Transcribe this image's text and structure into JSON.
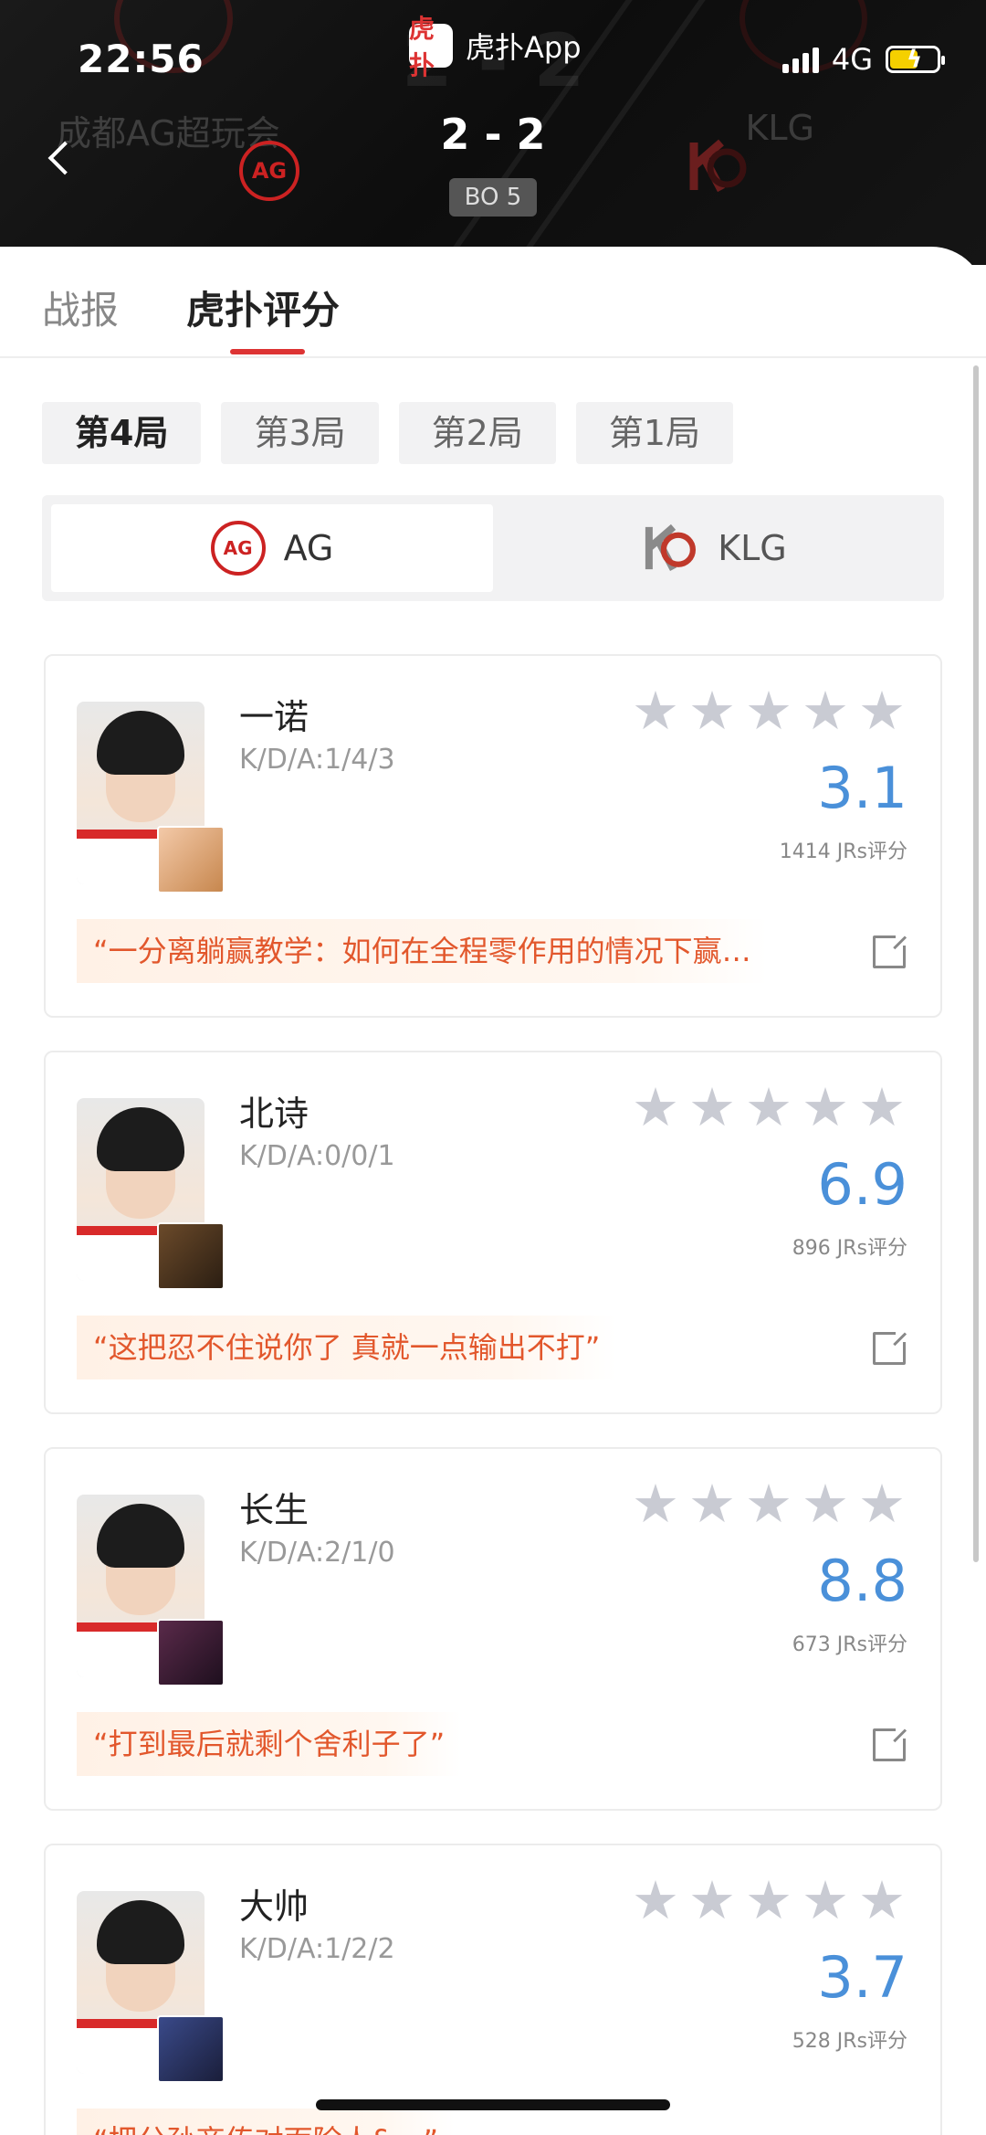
{
  "status_bar": {
    "time": "22:56",
    "app_name": "虎扑App",
    "app_icon_text": "虎扑",
    "network": "4G"
  },
  "match": {
    "score": "2 - 2",
    "format": "BO 5",
    "home_team_bg": "成都AG超玩会",
    "away_team_bg": "KLG",
    "home_logo_text": "AG",
    "ghost_score": "2 - 2"
  },
  "tabs": [
    {
      "label": "战报"
    },
    {
      "label": "虎扑评分"
    }
  ],
  "rounds": [
    {
      "label": "第4局"
    },
    {
      "label": "第3局"
    },
    {
      "label": "第2局"
    },
    {
      "label": "第1局"
    }
  ],
  "team_toggle": [
    {
      "label": "AG"
    },
    {
      "label": "KLG"
    }
  ],
  "players": [
    {
      "name": "一诺",
      "kda": "K/D/A:1/4/3",
      "rating": "3.1",
      "count": "1414 JRs评分",
      "quote": "“一分离躺赢教学：如何在全程零作用的情况下赢…"
    },
    {
      "name": "北诗",
      "kda": "K/D/A:0/0/1",
      "rating": "6.9",
      "count": "896 JRs评分",
      "quote": "“这把忍不住说你了 真就一点输出不打”"
    },
    {
      "name": "长生",
      "kda": "K/D/A:2/1/0",
      "rating": "8.8",
      "count": "673 JRs评分",
      "quote": "“打到最后就剩个舍利子了”"
    },
    {
      "name": "大帅",
      "kda": "K/D/A:1/2/2",
      "rating": "3.7",
      "count": "528 JRs评分",
      "quote": "“把分孙商传对面除人&…”"
    }
  ],
  "colors": {
    "accent": "#d33333",
    "rating": "#4a90d9",
    "quote": "#e2572c"
  }
}
